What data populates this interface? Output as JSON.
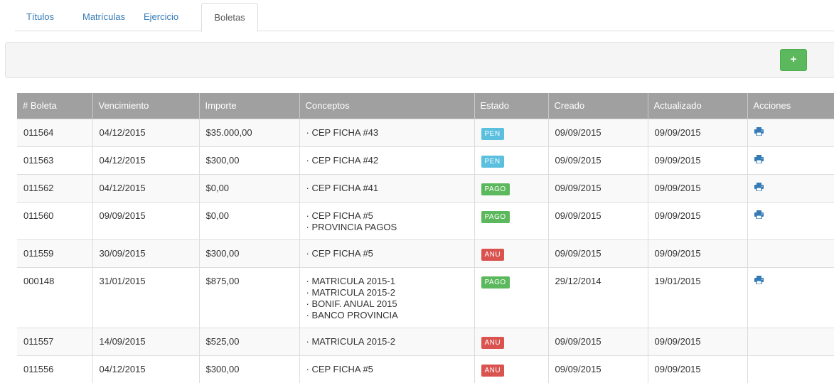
{
  "tabs": [
    {
      "label": "Títulos",
      "active": false
    },
    {
      "label": "Matrículas",
      "active": false
    },
    {
      "label": "Ejercicio",
      "active": false
    },
    {
      "label": "Boletas",
      "active": true
    }
  ],
  "toolbar": {
    "add_label": "+",
    "add_color": "#5cb85c"
  },
  "colors": {
    "pen": "#5bc0de",
    "pago": "#5cb85c",
    "anu": "#d9534f",
    "header": "#a0a0a0"
  },
  "table": {
    "headers": [
      "# Boleta",
      "Vencimiento",
      "Importe",
      "Conceptos",
      "Estado",
      "Creado",
      "Actualizado",
      "Acciones"
    ],
    "rows": [
      {
        "boleta": "011564",
        "vencimiento": "04/12/2015",
        "importe": "$35.000,00",
        "conceptos": [
          "· CEP FICHA #43"
        ],
        "estado": "PEN",
        "estado_type": "pen",
        "creado": "09/09/2015",
        "actualizado": "09/09/2015",
        "print": true
      },
      {
        "boleta": "011563",
        "vencimiento": "04/12/2015",
        "importe": "$300,00",
        "conceptos": [
          "· CEP FICHA #42"
        ],
        "estado": "PEN",
        "estado_type": "pen",
        "creado": "09/09/2015",
        "actualizado": "09/09/2015",
        "print": true
      },
      {
        "boleta": "011562",
        "vencimiento": "04/12/2015",
        "importe": "$0,00",
        "conceptos": [
          "· CEP FICHA #41"
        ],
        "estado": "PAGO",
        "estado_type": "pago",
        "creado": "09/09/2015",
        "actualizado": "09/09/2015",
        "print": true
      },
      {
        "boleta": "011560",
        "vencimiento": "09/09/2015",
        "importe": "$0,00",
        "conceptos": [
          "· CEP FICHA #5",
          "· PROVINCIA PAGOS"
        ],
        "estado": "PAGO",
        "estado_type": "pago",
        "creado": "09/09/2015",
        "actualizado": "09/09/2015",
        "print": true
      },
      {
        "boleta": "011559",
        "vencimiento": "30/09/2015",
        "importe": "$300,00",
        "conceptos": [
          "· CEP FICHA #5"
        ],
        "estado": "ANU",
        "estado_type": "anu",
        "creado": "09/09/2015",
        "actualizado": "09/09/2015",
        "print": false
      },
      {
        "boleta": "000148",
        "vencimiento": "31/01/2015",
        "importe": "$875,00",
        "conceptos": [
          "· MATRICULA 2015-1",
          "· MATRICULA 2015-2",
          "· BONIF. ANUAL 2015",
          "· BANCO PROVINCIA"
        ],
        "estado": "PAGO",
        "estado_type": "pago",
        "creado": "29/12/2014",
        "actualizado": "19/01/2015",
        "print": true
      },
      {
        "boleta": "011557",
        "vencimiento": "14/09/2015",
        "importe": "$525,00",
        "conceptos": [
          "· MATRICULA 2015-2"
        ],
        "estado": "ANU",
        "estado_type": "anu",
        "creado": "09/09/2015",
        "actualizado": "09/09/2015",
        "print": false
      },
      {
        "boleta": "011556",
        "vencimiento": "04/12/2015",
        "importe": "$300,00",
        "conceptos": [
          "· CEP FICHA #5"
        ],
        "estado": "ANU",
        "estado_type": "anu",
        "creado": "09/09/2015",
        "actualizado": "09/09/2015",
        "print": false
      }
    ]
  }
}
